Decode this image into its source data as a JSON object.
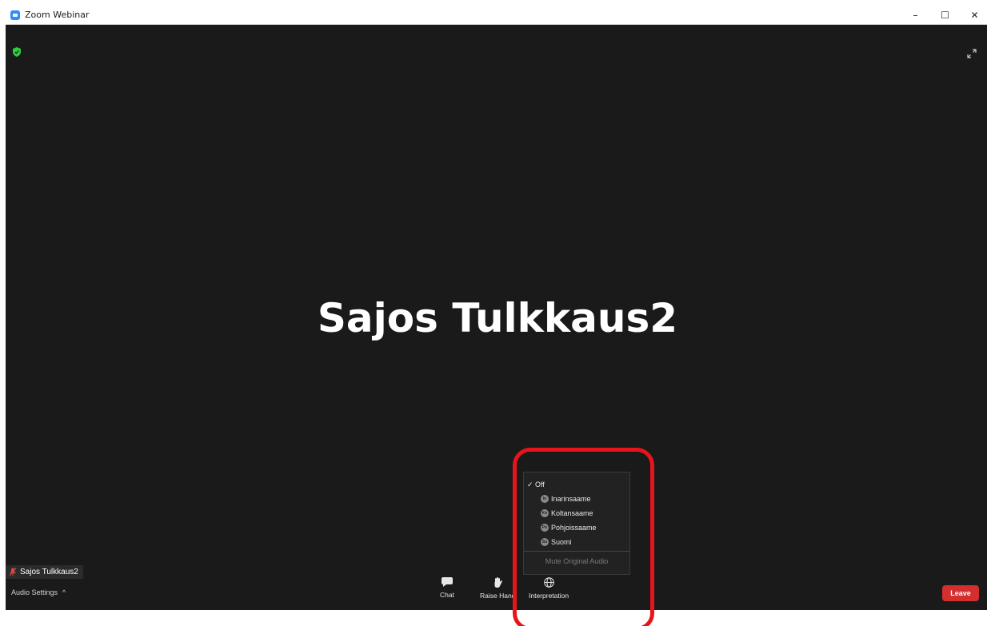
{
  "window": {
    "title": "Zoom Webinar",
    "minimize_glyph": "–",
    "maximize_glyph": "☐",
    "close_glyph": "✕"
  },
  "meeting": {
    "speaker_name": "Sajos Tulkkaus2",
    "name_tag": "Sajos Tulkkaus2"
  },
  "controls": {
    "audio_settings": "Audio Settings",
    "audio_caret": "^",
    "chat": "Chat",
    "raise_hand": "Raise Hand",
    "interpretation": "Interpretation",
    "leave": "Leave"
  },
  "interpretation_menu": {
    "off": "Off",
    "check_glyph": "✓",
    "languages": [
      {
        "badge": "In",
        "name": "Inarinsaame"
      },
      {
        "badge": "Ko",
        "name": "Koltansaame"
      },
      {
        "badge": "Po",
        "name": "Pohjoissaame"
      },
      {
        "badge": "Su",
        "name": "Suomi"
      }
    ],
    "mute_original": "Mute Original Audio"
  },
  "colors": {
    "video_bg": "#1a1a1a",
    "leave": "#d32f2f",
    "highlight": "#e8141c",
    "shield": "#2ecc40"
  },
  "icons": [
    "app-icon",
    "shield-icon",
    "fullscreen-icon",
    "muted-mic-icon",
    "chat-icon",
    "raise-hand-icon",
    "globe-icon"
  ]
}
